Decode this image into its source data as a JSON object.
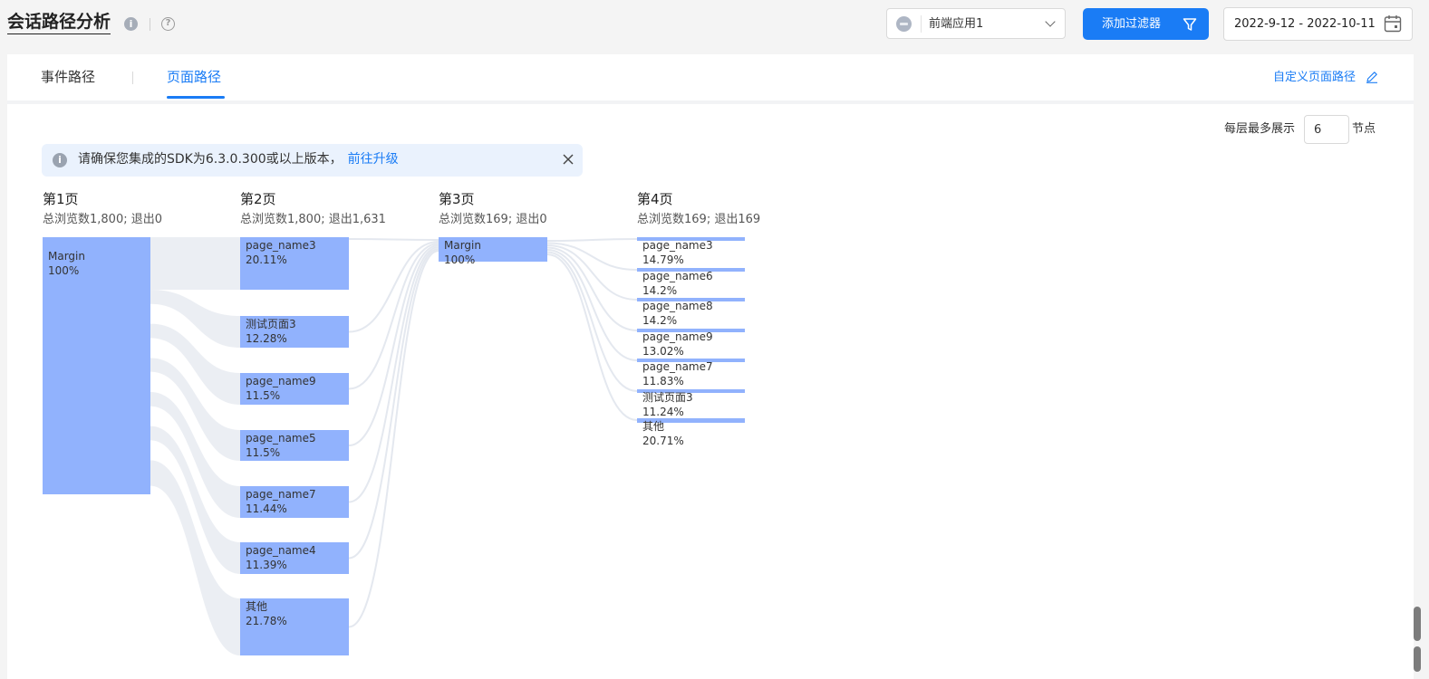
{
  "header": {
    "title": "会话路径分析",
    "info_icon": "info-icon",
    "help_icon": "question-circle-icon",
    "help_glyph": "?",
    "info_glyph": "i",
    "app_select_value": "前端应用1",
    "filter_button_label": "添加过滤器",
    "date_range": "2022-9-12 - 2022-10-11"
  },
  "tabs": [
    {
      "label": "事件路径",
      "active": false
    },
    {
      "label": "页面路径",
      "active": true
    }
  ],
  "custom_path_label": "自定义页面路径",
  "max_display": {
    "prefix": "每层最多展示",
    "value": "6",
    "suffix": "节点"
  },
  "alert": {
    "text": "请确保您集成的SDK为6.3.0.300或以上版本，",
    "link": "前往升级"
  },
  "colors": {
    "accent": "#1a7cf5",
    "node": "#91b2fd",
    "link": "#e4e8ef"
  },
  "chart_data": {
    "type": "sankey",
    "columns": [
      {
        "title": "第1页",
        "summary": "总浏览数1,800; 退出0",
        "nodes": [
          {
            "name": "Margin",
            "pct": "100%"
          }
        ]
      },
      {
        "title": "第2页",
        "summary": "总浏览数1,800; 退出1,631",
        "nodes": [
          {
            "name": "page_name3",
            "pct": "20.11%"
          },
          {
            "name": "测试页面3",
            "pct": "12.28%"
          },
          {
            "name": "page_name9",
            "pct": "11.5%"
          },
          {
            "name": "page_name5",
            "pct": "11.5%"
          },
          {
            "name": "page_name7",
            "pct": "11.44%"
          },
          {
            "name": "page_name4",
            "pct": "11.39%"
          },
          {
            "name": "其他",
            "pct": "21.78%"
          }
        ]
      },
      {
        "title": "第3页",
        "summary": "总浏览数169; 退出0",
        "nodes": [
          {
            "name": "Margin",
            "pct": "100%"
          }
        ]
      },
      {
        "title": "第4页",
        "summary": "总浏览数169; 退出169",
        "nodes": [
          {
            "name": "page_name3",
            "pct": "14.79%"
          },
          {
            "name": "page_name6",
            "pct": "14.2%"
          },
          {
            "name": "page_name8",
            "pct": "14.2%"
          },
          {
            "name": "page_name9",
            "pct": "13.02%"
          },
          {
            "name": "page_name7",
            "pct": "11.83%"
          },
          {
            "name": "测试页面3",
            "pct": "11.24%"
          },
          {
            "name": "其他",
            "pct": "20.71%"
          }
        ]
      }
    ]
  }
}
